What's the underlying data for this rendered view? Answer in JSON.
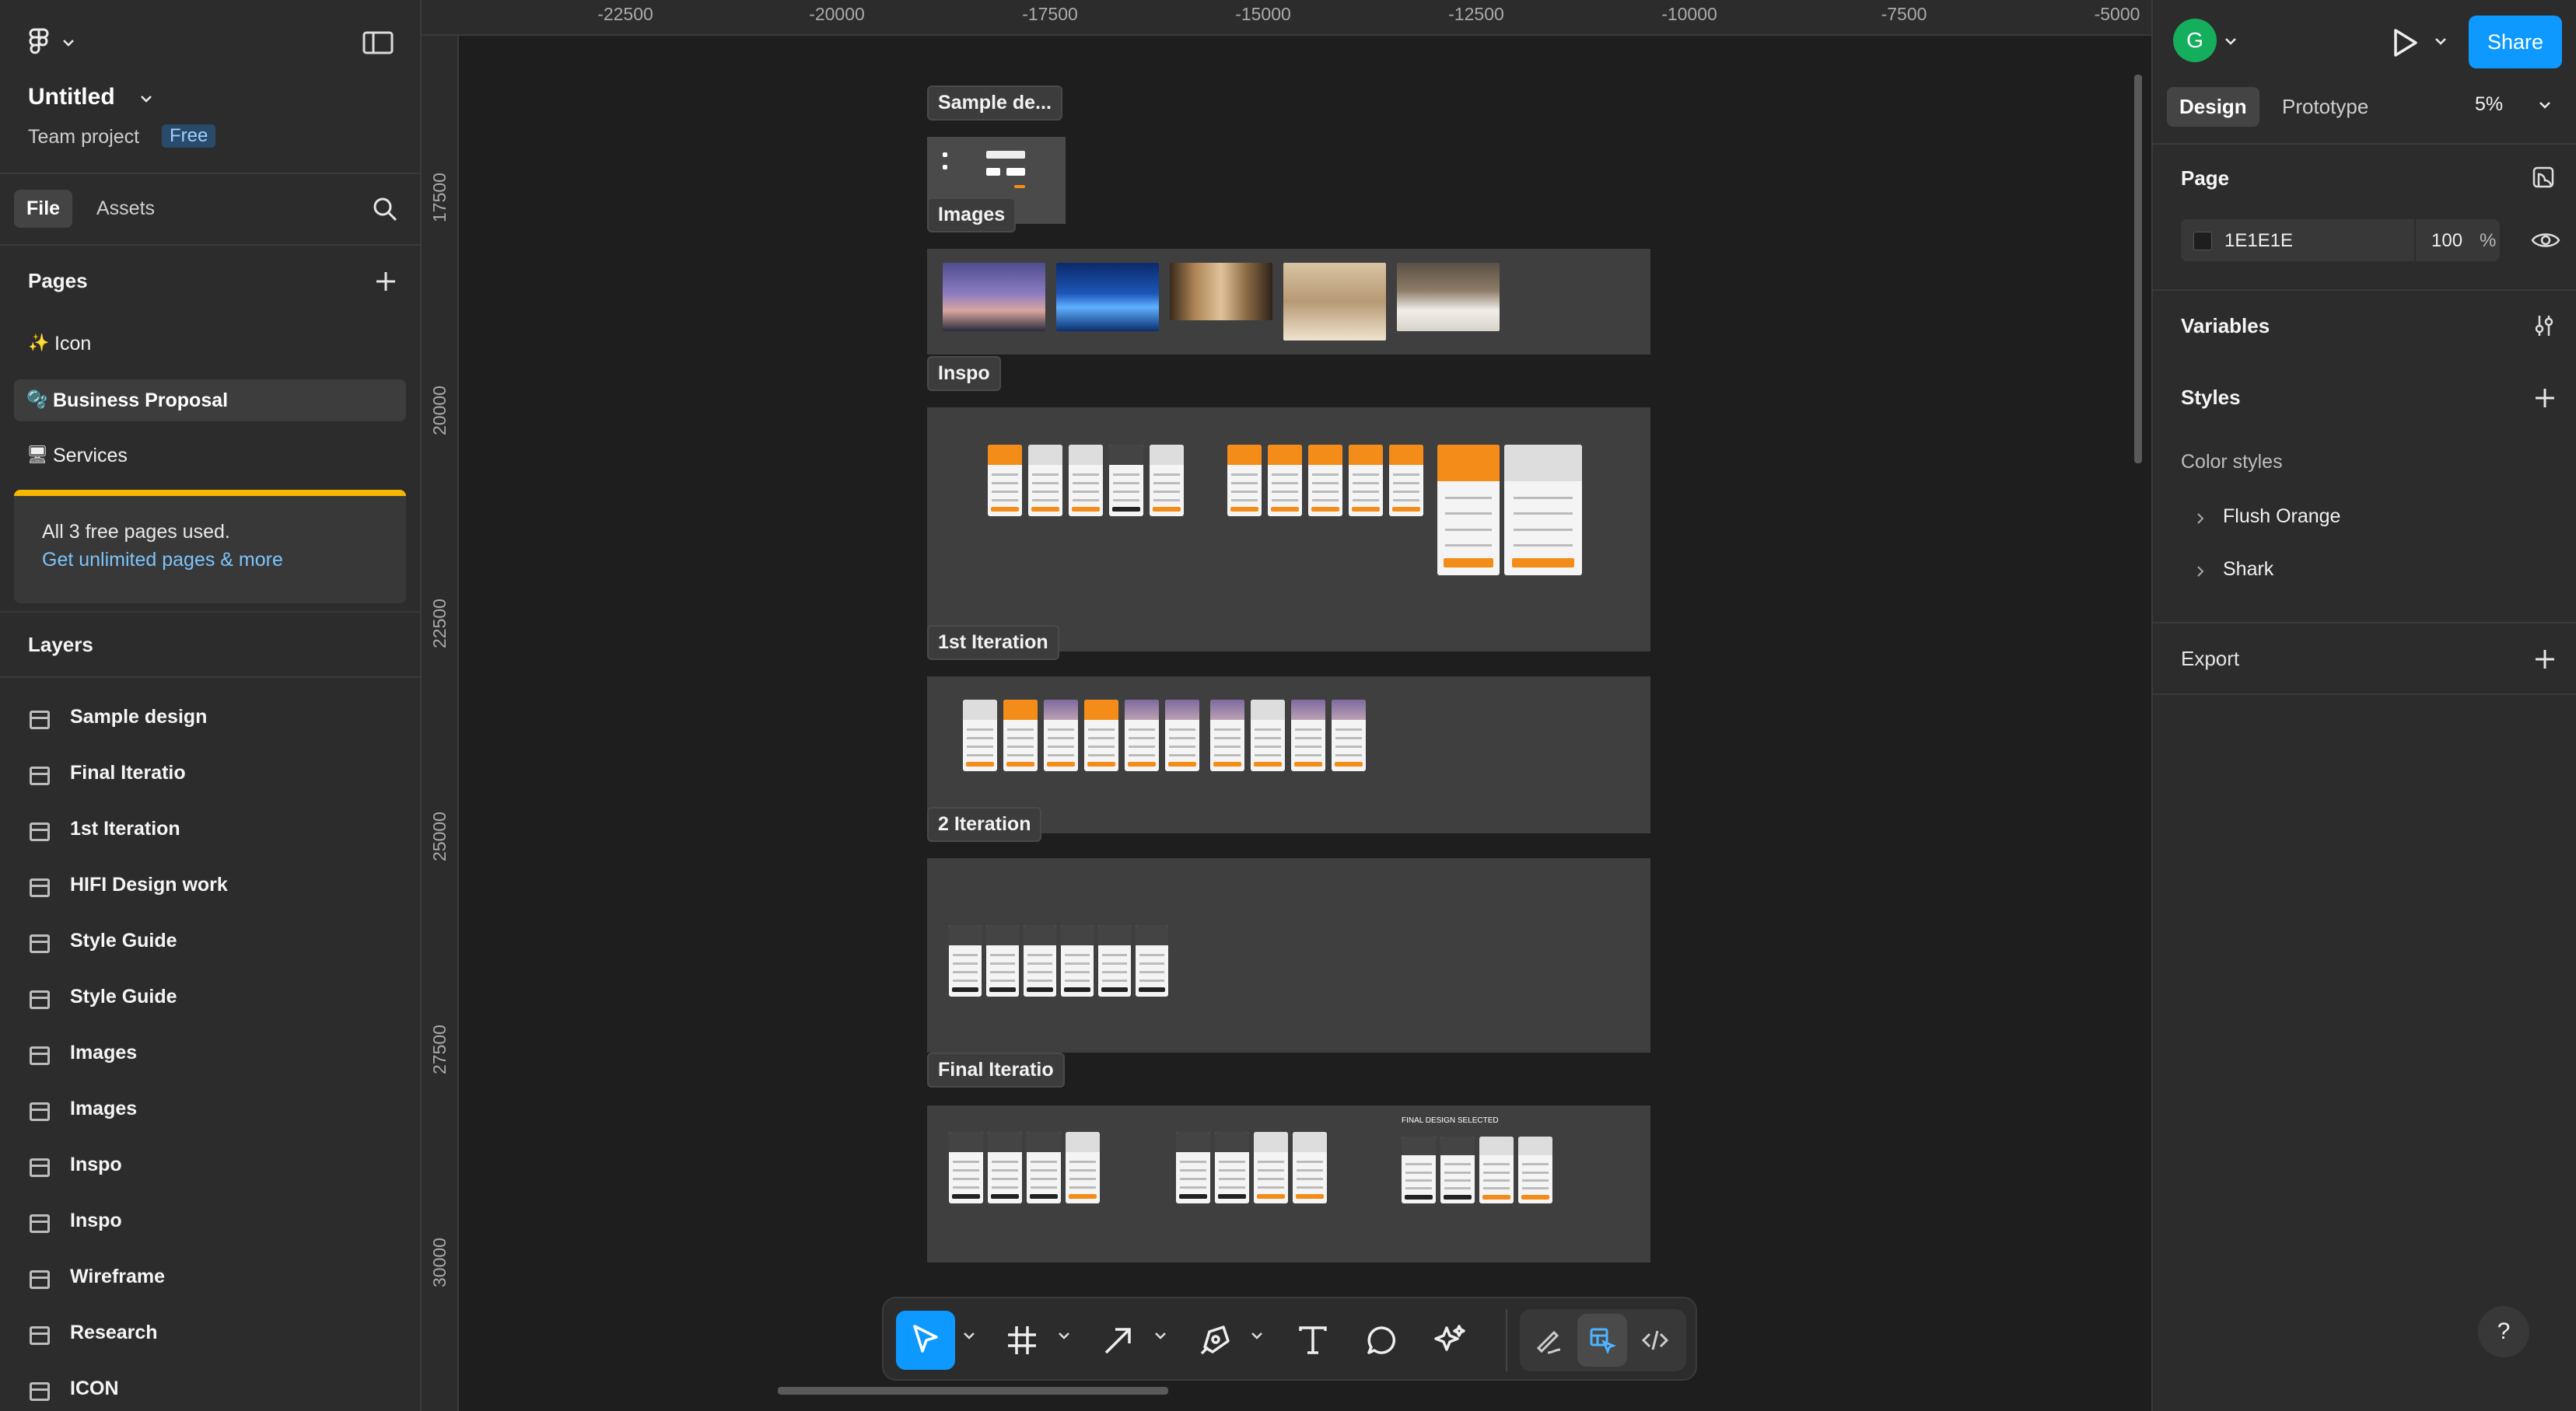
{
  "app": {
    "file_title": "Untitled",
    "team_label": "Team project",
    "plan_badge": "Free"
  },
  "left_panel": {
    "tabs": [
      "File",
      "Assets"
    ],
    "pages_title": "Pages",
    "pages": [
      {
        "emoji": "✨",
        "label": "Icon"
      },
      {
        "emoji": "🫧",
        "label": "Business Proposal"
      },
      {
        "emoji": "🖥",
        "label": "Services"
      }
    ],
    "notice": {
      "line1": "All 3 free pages used.",
      "link": "Get unlimited pages & more"
    },
    "layers_title": "Layers",
    "layers": [
      "Sample design",
      "Final Iteratio",
      "1st Iteration",
      "HIFI Design work",
      "Style Guide",
      "Style Guide",
      "Images",
      "Images",
      "Inspo",
      "Inspo",
      "Wireframe",
      "Research",
      "ICON"
    ]
  },
  "canvas": {
    "ruler_top": [
      "-22500",
      "-20000",
      "-17500",
      "-15000",
      "-12500",
      "-10000",
      "-7500",
      "-5000"
    ],
    "ruler_left": [
      "17500",
      "20000",
      "22500",
      "25000",
      "27500",
      "30000"
    ],
    "frame_labels": {
      "sample": "Sample de...",
      "images": "Images",
      "inspo": "Inspo",
      "iter1": "1st Iteration",
      "iter2": "2 Iteration",
      "final": "Final Iteratio"
    },
    "final_design_note": "FINAL DESIGN SELECTED"
  },
  "toolbar": {
    "tools": [
      "move-tool",
      "frame-tool",
      "arrow-tool",
      "pen-tool",
      "text-tool",
      "comment-tool",
      "ai-tool",
      "draw-mode",
      "design-mode",
      "dev-mode"
    ]
  },
  "right_panel": {
    "avatar_letter": "G",
    "share_label": "Share",
    "tabs": [
      "Design",
      "Prototype"
    ],
    "zoom": "5%",
    "page_section": "Page",
    "page_color": "1E1E1E",
    "page_opacity": "100",
    "percent_sign": "%",
    "variables_section": "Variables",
    "styles_section": "Styles",
    "color_styles_label": "Color styles",
    "color_styles": [
      "Flush Orange",
      "Shark"
    ],
    "export_section": "Export",
    "help": "?"
  },
  "colors": {
    "accent": "#0d99ff",
    "orange": "#f48c1a",
    "avatar": "#14ae5c",
    "notice_bar": "#f5b700"
  }
}
